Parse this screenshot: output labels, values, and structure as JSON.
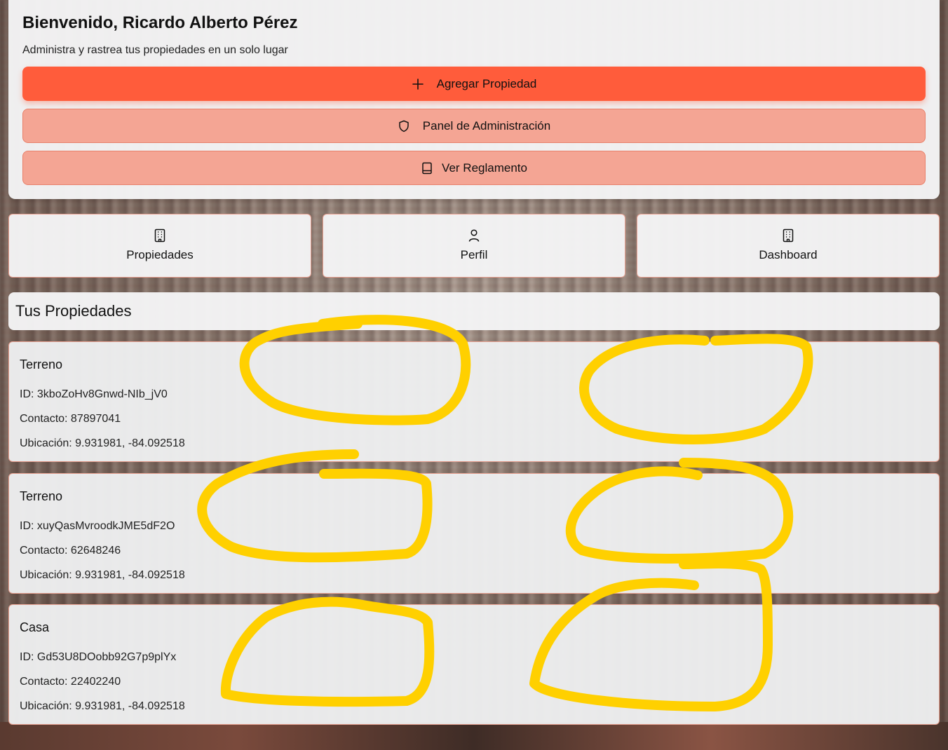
{
  "header": {
    "title": "Bienvenido, Ricardo Alberto Pérez",
    "subtitle": "Administra y rastrea tus propiedades en un solo lugar"
  },
  "actions": {
    "add_property": "Agregar Propiedad",
    "admin_panel": "Panel de Administración",
    "view_rules": "Ver Reglamento"
  },
  "tabs": [
    {
      "label": "Propiedades",
      "icon": "building-icon"
    },
    {
      "label": "Perfil",
      "icon": "user-icon"
    },
    {
      "label": "Dashboard",
      "icon": "building-icon"
    }
  ],
  "section_title": "Tus Propiedades",
  "properties": [
    {
      "type": "Terreno",
      "id_line": "ID: 3kboZoHv8Gnwd-NIb_jV0",
      "contact_line": "Contacto: 87897041",
      "location_line": "Ubicación: 9.931981, -84.092518"
    },
    {
      "type": "Terreno",
      "id_line": "ID: xuyQasMvroodkJME5dF2O",
      "contact_line": "Contacto: 62648246",
      "location_line": "Ubicación: 9.931981, -84.092518"
    },
    {
      "type": "Casa",
      "id_line": "ID: Gd53U8DOobb92G7p9plYx",
      "contact_line": "Contacto: 22402240",
      "location_line": "Ubicación: 9.931981, -84.092518"
    }
  ],
  "colors": {
    "primary": "#ff5c3b",
    "soft": "#f4a594",
    "annotation": "#ffd000"
  }
}
